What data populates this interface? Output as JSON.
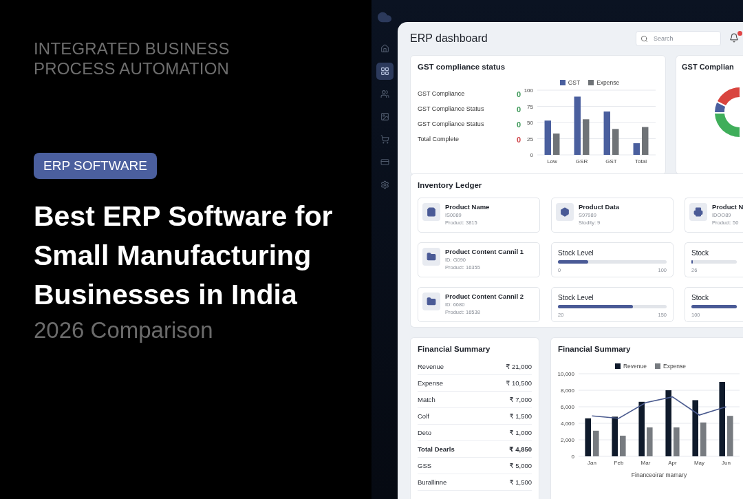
{
  "hero": {
    "eyebrow": "INTEGRATED BUSINESS PROCESS AUTOMATION",
    "tag": "ERP SOFTWARE",
    "title": "Best ERP Software for Small Manufacturing Businesses in India",
    "subtitle": "2026 Comparison"
  },
  "sidebar": {
    "items": [
      {
        "selected": false
      },
      {
        "selected": true
      },
      {
        "selected": false
      },
      {
        "selected": false
      },
      {
        "selected": false
      },
      {
        "selected": false
      },
      {
        "selected": false
      }
    ]
  },
  "header": {
    "title": "ERP dashboard",
    "search": {
      "placeholder": "Search"
    },
    "notifications": {
      "unread": true
    }
  },
  "gst_card": {
    "title": "GST compliance status",
    "items": [
      {
        "label": "GST Compliance",
        "value": "0",
        "color": "#3f9a5a"
      },
      {
        "label": "GST Compliance Status",
        "value": "0",
        "color": "#3f9a5a"
      },
      {
        "label": "GST Compliance Status",
        "value": "0",
        "color": "#3f9a5a"
      },
      {
        "label": "Total Complete",
        "value": "0",
        "color": "#d0454a"
      }
    ],
    "chart_data": {
      "type": "bar",
      "grid": true,
      "legend": true,
      "categories": [
        "Low",
        "GSR",
        "GST",
        "Total"
      ],
      "ylim": [
        0,
        100
      ],
      "yticks": [
        0,
        25,
        50,
        75,
        100
      ],
      "series": [
        {
          "name": "GST",
          "color": "#4a5f9e",
          "values": [
            53,
            90,
            67,
            18
          ]
        },
        {
          "name": "Expense",
          "color": "#6f7377",
          "values": [
            33,
            55,
            40,
            43
          ]
        }
      ]
    }
  },
  "gst_side_card": {
    "title": "GST Complian"
  },
  "inventory": {
    "title": "Inventory Ledger",
    "cards": [
      {
        "kind": "product",
        "name": "Product Name",
        "id": "IS0089",
        "detail": "Product: 3815"
      },
      {
        "kind": "product",
        "name": "Product Data",
        "id": "S97989",
        "detail": "Stodity: 9"
      },
      {
        "kind": "product",
        "name": "Product N",
        "id": "IDOO89",
        "detail": "Product: 50"
      },
      {
        "kind": "product",
        "name": "Product Content Cannil 1",
        "id": "ID: G090",
        "detail": "Product: 16355"
      },
      {
        "kind": "stock",
        "title": "Stock Level",
        "level": 0.28,
        "min": "0",
        "max": "100"
      },
      {
        "kind": "stock",
        "title": "Stock",
        "level": 0.03,
        "min": "26"
      },
      {
        "kind": "product",
        "name": "Product Content Cannil 2",
        "id": "ID: 6680",
        "detail": "Product: 16538"
      },
      {
        "kind": "stock",
        "title": "Stock Level",
        "level": 0.69,
        "min": "20",
        "max": "150"
      },
      {
        "kind": "stock",
        "title": "Stock",
        "level": 1,
        "min": "100"
      }
    ]
  },
  "financial_table": {
    "title": "Financial Summary",
    "rows": [
      {
        "label": "Revenue",
        "value": "₹ 21,000",
        "total": false
      },
      {
        "label": "Expense",
        "value": "₹ 10,500",
        "total": false
      },
      {
        "label": "Match",
        "value": "₹ 7,000",
        "total": false
      },
      {
        "label": "Colf",
        "value": "₹ 1,500",
        "total": false
      },
      {
        "label": "Deto",
        "value": "₹ 1,000",
        "total": false
      },
      {
        "label": "Total Dearls",
        "value": "₹ 4,850",
        "total": true
      },
      {
        "label": "GSS",
        "value": "₹ 5,000",
        "total": false
      },
      {
        "label": "Burallinne",
        "value": "₹ 1,500",
        "total": false
      }
    ]
  },
  "financial_chart": {
    "title": "Financial Summary",
    "chart_data": {
      "type": "bar",
      "grid": true,
      "legend": true,
      "xlabel": "Financeoirar mamary",
      "categories": [
        "Jan",
        "Feb",
        "Mar",
        "Apr",
        "May",
        "Jun"
      ],
      "ylim": [
        0,
        10000
      ],
      "yticks": [
        {
          "value": 0,
          "label": "0"
        },
        {
          "value": 2000,
          "label": "2,000"
        },
        {
          "value": 4000,
          "label": "4,000"
        },
        {
          "value": 6000,
          "label": "6,000"
        },
        {
          "value": 8000,
          "label": "8,000"
        },
        {
          "value": 10000,
          "label": "10,000"
        }
      ],
      "series": [
        {
          "name": "Revenue",
          "color": "#0f1a2b",
          "values": [
            4600,
            4800,
            6600,
            8000,
            6800,
            9000
          ]
        },
        {
          "name": "Expense",
          "color": "#777b80",
          "values": [
            3100,
            2500,
            3500,
            3500,
            4100,
            4900
          ]
        },
        {
          "type": "line",
          "color": "#4a5a8e",
          "values": [
            4900,
            4600,
            6500,
            7200,
            5000,
            6000
          ]
        }
      ]
    }
  }
}
